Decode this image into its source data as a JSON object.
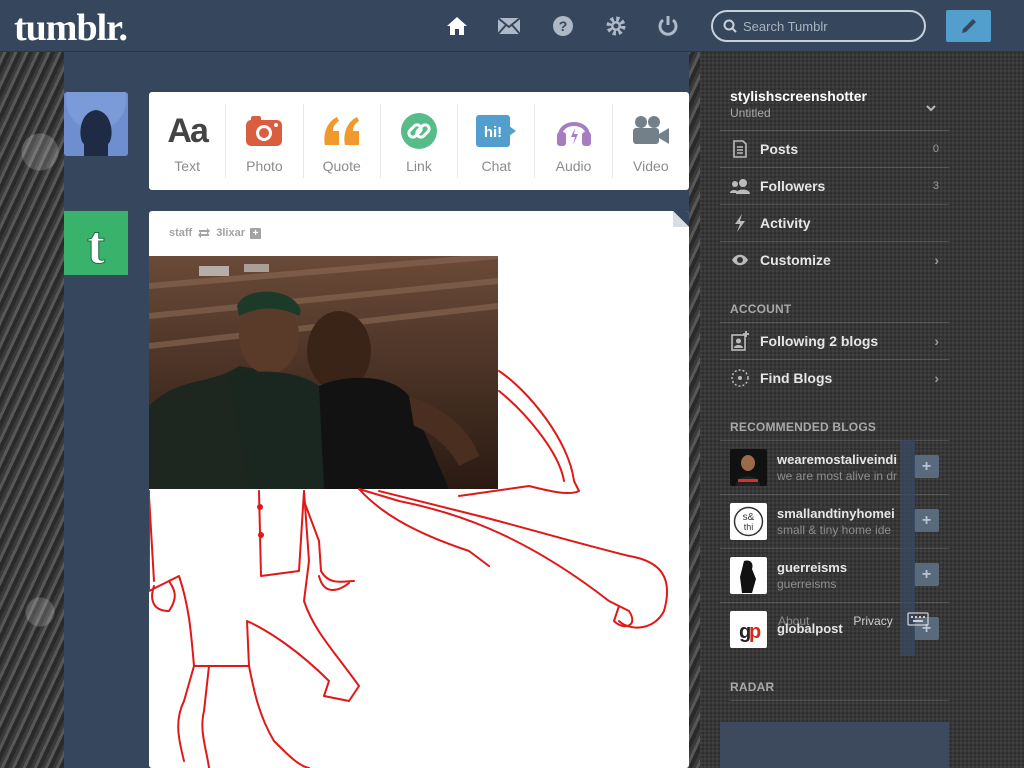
{
  "header": {
    "logo": "tumblr.",
    "nav_icons": [
      "home-icon",
      "mail-icon",
      "help-icon",
      "gear-icon",
      "power-icon"
    ],
    "search_placeholder": "Search Tumblr",
    "compose_icon": "pencil-icon"
  },
  "post_types": [
    {
      "label": "Text",
      "icon": "Aa",
      "color": "#444444"
    },
    {
      "label": "Photo",
      "icon": "camera-icon",
      "color": "#d95e40"
    },
    {
      "label": "Quote",
      "icon": "quote-icon",
      "color": "#f2992e"
    },
    {
      "label": "Link",
      "icon": "link-icon",
      "color": "#56bc8a"
    },
    {
      "label": "Chat",
      "icon": "hi!",
      "color": "#529ecc"
    },
    {
      "label": "Audio",
      "icon": "headphones-icon",
      "color": "#a77dc2"
    },
    {
      "label": "Video",
      "icon": "video-camera-icon",
      "color": "#748089"
    }
  ],
  "post": {
    "author": "staff",
    "reblogged_from": "3lixar"
  },
  "sidebar": {
    "blog_name": "stylishscreenshotter",
    "blog_subtitle": "Untitled",
    "items": [
      {
        "label": "Posts",
        "count": "0"
      },
      {
        "label": "Followers",
        "count": "3"
      },
      {
        "label": "Activity",
        "count": ""
      },
      {
        "label": "Customize",
        "count": ""
      }
    ],
    "account_heading": "ACCOUNT",
    "account_items": [
      {
        "label": "Following 2 blogs"
      },
      {
        "label": "Find Blogs"
      }
    ],
    "recommended_heading": "RECOMMENDED BLOGS",
    "recommended": [
      {
        "name": "wearemostaliveindi",
        "desc": "we are most alive in dr"
      },
      {
        "name": "smallandtinyhomei",
        "desc": "small & tiny home ide"
      },
      {
        "name": "guerreisms",
        "desc": "guerreisms"
      },
      {
        "name": "globalpost",
        "desc": ""
      }
    ],
    "footer_about": "About",
    "footer_privacy": "Privacy",
    "radar_heading": "RADAR"
  },
  "colors": {
    "header_bg": "#36465d",
    "accent_blue": "#529ecc"
  }
}
